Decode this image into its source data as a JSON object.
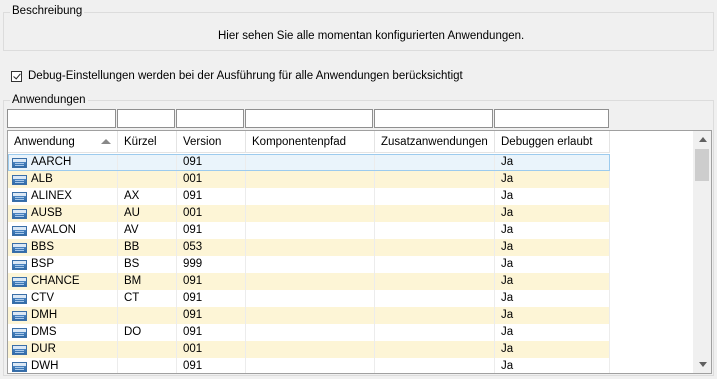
{
  "description_group": {
    "legend": "Beschreibung",
    "text": "Hier sehen Sie alle momentan konfigurierten Anwendungen."
  },
  "debug_option": {
    "label": "Debug-Einstellungen werden bei der Ausführung für alle Anwendungen berücksichtigt",
    "checked": true
  },
  "apps_group": {
    "legend": "Anwendungen"
  },
  "grid": {
    "sorted_column": "Anwendung",
    "sort_direction": "ascending",
    "columns": [
      "Anwendung",
      "Kürzel",
      "Version",
      "Komponentenpfad",
      "Zusatzanwendungen",
      "Debuggen erlaubt"
    ],
    "rows": [
      {
        "app": "AARCH",
        "short": "",
        "version": "091",
        "path": "",
        "extra": "",
        "debug": "Ja"
      },
      {
        "app": "ALB",
        "short": "",
        "version": "001",
        "path": "",
        "extra": "",
        "debug": "Ja"
      },
      {
        "app": "ALINEX",
        "short": "AX",
        "version": "091",
        "path": "",
        "extra": "",
        "debug": "Ja"
      },
      {
        "app": "AUSB",
        "short": "AU",
        "version": "001",
        "path": "",
        "extra": "",
        "debug": "Ja"
      },
      {
        "app": "AVALON",
        "short": "AV",
        "version": "091",
        "path": "",
        "extra": "",
        "debug": "Ja"
      },
      {
        "app": "BBS",
        "short": "BB",
        "version": "053",
        "path": "",
        "extra": "",
        "debug": "Ja"
      },
      {
        "app": "BSP",
        "short": "BS",
        "version": "999",
        "path": "",
        "extra": "",
        "debug": "Ja"
      },
      {
        "app": "CHANCE",
        "short": "BM",
        "version": "091",
        "path": "",
        "extra": "",
        "debug": "Ja"
      },
      {
        "app": "CTV",
        "short": "CT",
        "version": "091",
        "path": "",
        "extra": "",
        "debug": "Ja"
      },
      {
        "app": "DMH",
        "short": "",
        "version": "091",
        "path": "",
        "extra": "",
        "debug": "Ja"
      },
      {
        "app": "DMS",
        "short": "DO",
        "version": "091",
        "path": "",
        "extra": "",
        "debug": "Ja"
      },
      {
        "app": "DUR",
        "short": "",
        "version": "001",
        "path": "",
        "extra": "",
        "debug": "Ja"
      },
      {
        "app": "DWH",
        "short": "",
        "version": "091",
        "path": "",
        "extra": "",
        "debug": "Ja"
      }
    ]
  },
  "colors": {
    "alternate_row": "#fdf5d6",
    "selected_row": "#eaf4fb"
  }
}
